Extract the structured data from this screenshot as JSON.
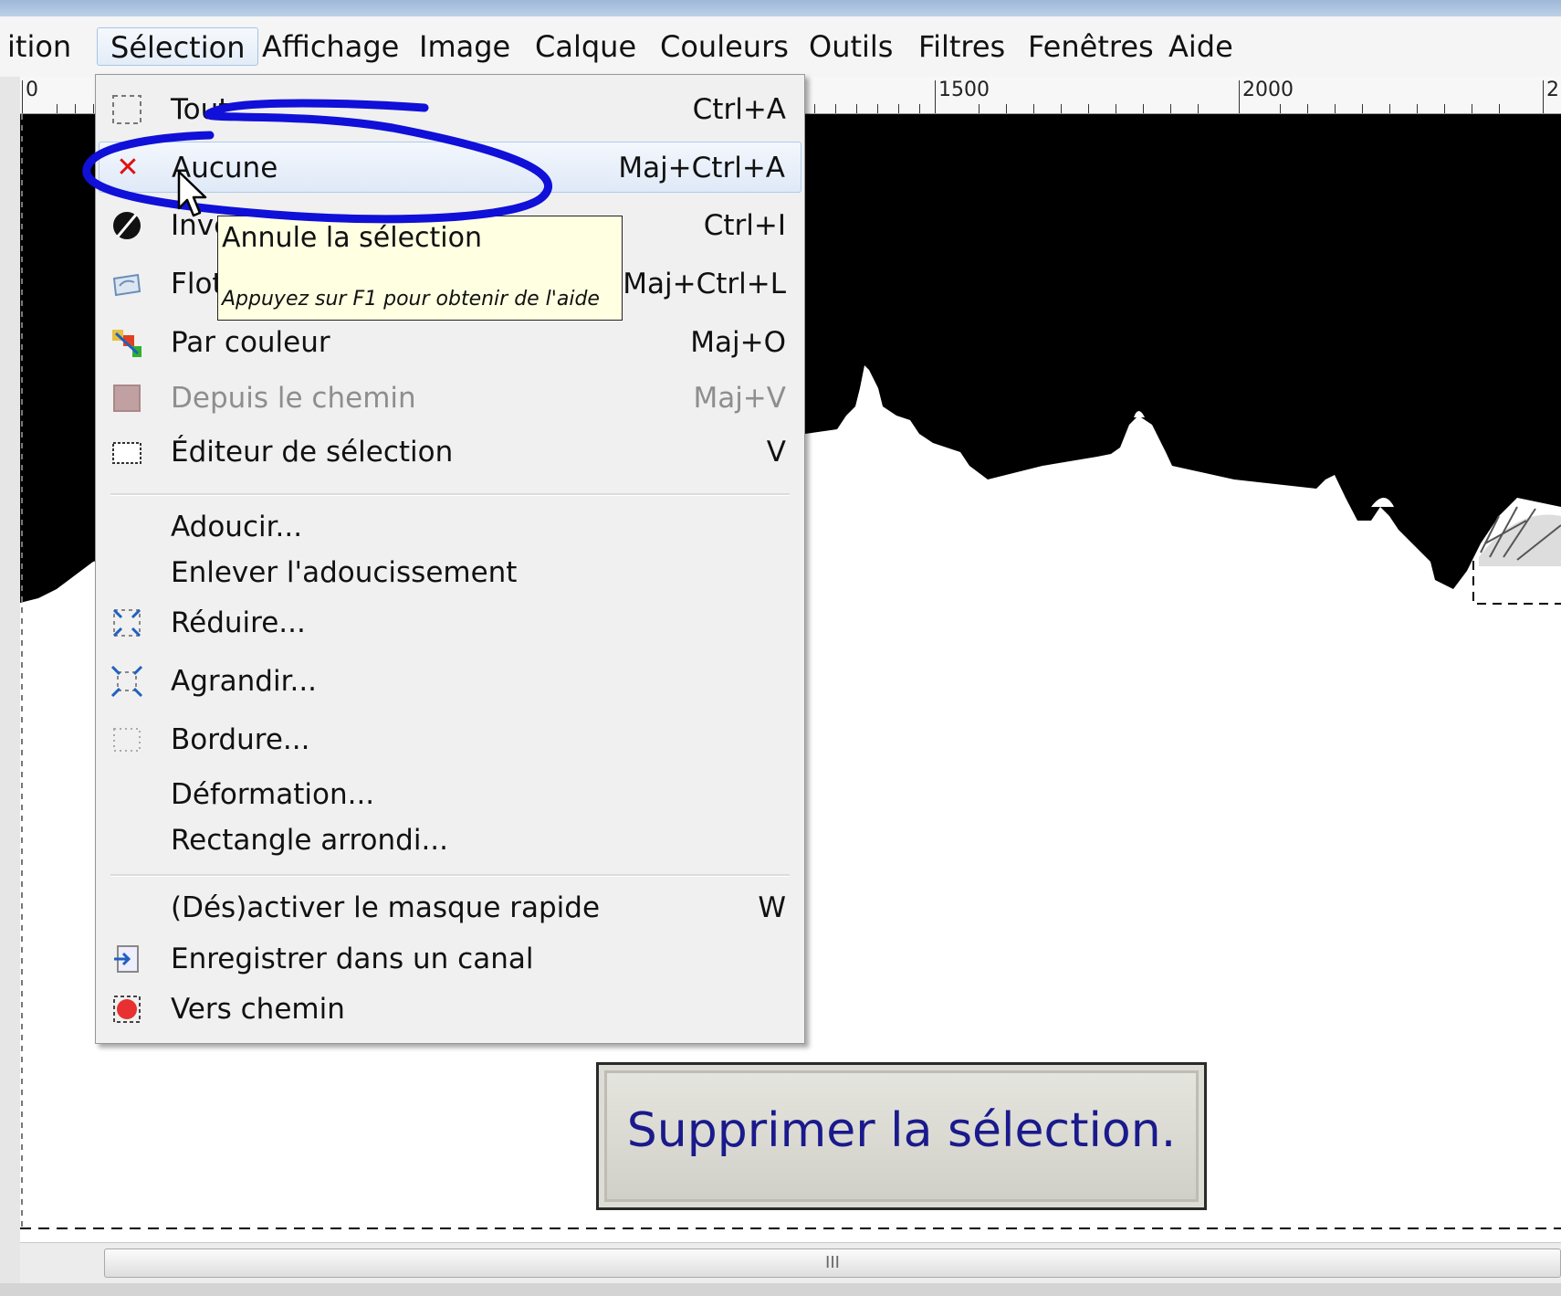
{
  "menubar": {
    "items": [
      "ition",
      "Sélection",
      "Affichage",
      "Image",
      "Calque",
      "Couleurs",
      "Outils",
      "Filtres",
      "Fenêtres",
      "Aide"
    ],
    "active_index": 1
  },
  "ruler": {
    "labels": [
      "0",
      "1500",
      "2000",
      "2"
    ]
  },
  "menu": {
    "items": [
      {
        "label": "Tout",
        "shortcut": "Ctrl+A",
        "icon": "select-all-icon"
      },
      {
        "label": "Aucune",
        "shortcut": "Maj+Ctrl+A",
        "icon": "select-none-icon",
        "highlighted": true
      },
      {
        "label": "Inve",
        "shortcut": "Ctrl+I",
        "icon": "invert-icon"
      },
      {
        "label": "Flot",
        "shortcut": "Maj+Ctrl+L",
        "icon": "float-icon"
      },
      {
        "label": "Par couleur",
        "shortcut": "Maj+O",
        "icon": "by-color-icon"
      },
      {
        "label": "Depuis le chemin",
        "shortcut": "Maj+V",
        "icon": "from-path-icon",
        "disabled": true
      },
      {
        "label": "Éditeur de sélection",
        "shortcut": "V",
        "icon": "selection-editor-icon"
      },
      {
        "label": "Adoucir...",
        "shortcut": "",
        "icon": ""
      },
      {
        "label": "Enlever l'adoucissement",
        "shortcut": "",
        "icon": ""
      },
      {
        "label": "Réduire...",
        "shortcut": "",
        "icon": "shrink-icon"
      },
      {
        "label": "Agrandir...",
        "shortcut": "",
        "icon": "grow-icon"
      },
      {
        "label": "Bordure...",
        "shortcut": "",
        "icon": "border-icon"
      },
      {
        "label": "Déformation...",
        "shortcut": "",
        "icon": ""
      },
      {
        "label": "Rectangle arrondi...",
        "shortcut": "",
        "icon": ""
      },
      {
        "label": "(Dés)activer le masque rapide",
        "shortcut": "W",
        "icon": ""
      },
      {
        "label": "Enregistrer dans un canal",
        "shortcut": "",
        "icon": "save-channel-icon"
      },
      {
        "label": "Vers chemin",
        "shortcut": "",
        "icon": "to-path-icon"
      }
    ]
  },
  "tooltip": {
    "title": "Annule la sélection",
    "hint": "Appuyez sur F1 pour obtenir de l'aide"
  },
  "annotation": {
    "text": "Supprimer la sélection."
  },
  "scrollbar": {
    "grip": "III"
  },
  "colors": {
    "marker": "#1010d8",
    "annotation_text": "#1a1a8c",
    "tooltip_bg": "#ffffe1"
  }
}
